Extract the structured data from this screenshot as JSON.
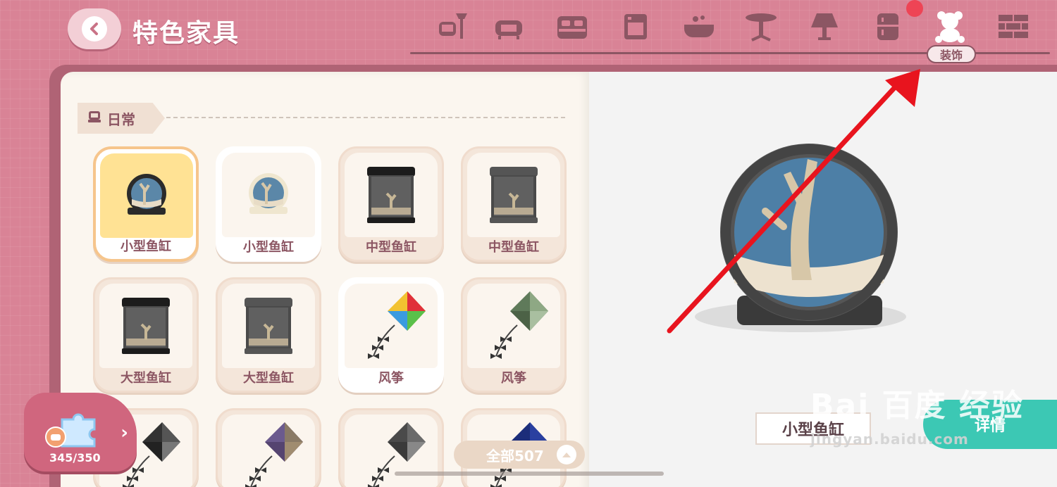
{
  "header": {
    "title": "特色家具",
    "categories": [
      {
        "icon": "armchair-lamp-icon"
      },
      {
        "icon": "sofa-icon"
      },
      {
        "icon": "bed-icon"
      },
      {
        "icon": "cabinet-icon"
      },
      {
        "icon": "bathtub-icon"
      },
      {
        "icon": "table-icon"
      },
      {
        "icon": "lamp-icon"
      },
      {
        "icon": "fridge-icon"
      },
      {
        "icon": "teddy-bear-icon",
        "active": true
      },
      {
        "icon": "brick-wall-icon"
      }
    ],
    "active_category_label": "装饰"
  },
  "section": {
    "label": "日常",
    "icon": "chair-icon"
  },
  "items": [
    {
      "label": "小型鱼缸",
      "kind": "round-tank",
      "frame": "#2b2b2b",
      "selected": true
    },
    {
      "label": "小型鱼缸",
      "kind": "round-tank",
      "frame": "#efe6cf"
    },
    {
      "label": "中型鱼缸",
      "kind": "box-tank",
      "frame": "#1c1c1c"
    },
    {
      "label": "中型鱼缸",
      "kind": "box-tank",
      "frame": "#555"
    },
    {
      "label": "大型鱼缸",
      "kind": "box-tank",
      "frame": "#1c1c1c"
    },
    {
      "label": "大型鱼缸",
      "kind": "box-tank",
      "frame": "#555"
    },
    {
      "label": "风筝",
      "kind": "kite-color"
    },
    {
      "label": "风筝",
      "kind": "kite-green"
    },
    {
      "label": "",
      "kind": "kite-dark"
    },
    {
      "label": "",
      "kind": "kite-purple"
    },
    {
      "label": "",
      "kind": "kite-grey"
    },
    {
      "label": "",
      "kind": "kite-blue"
    }
  ],
  "collection": {
    "count": "345/350"
  },
  "filter": {
    "label": "全部507"
  },
  "preview": {
    "name": "小型鱼缸",
    "detail_label": "详情"
  },
  "watermark": {
    "brand": "Bai 百度 经验",
    "url": "jingyan.baidu.com"
  },
  "colors": {
    "accent": "#d98396",
    "highlight": "#ffe294",
    "arrow": "#e8141e",
    "detail": "#3cc8b4"
  }
}
